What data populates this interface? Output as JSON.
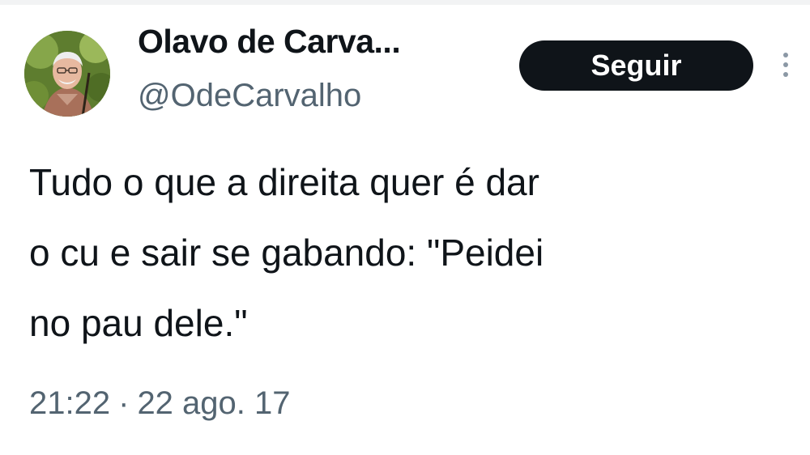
{
  "author": {
    "display_name": "Olavo de Carva...",
    "handle": "@OdeCarvalho"
  },
  "actions": {
    "follow_label": "Seguir",
    "more_icon": "more-vertical-icon"
  },
  "tweet": {
    "text": "Tudo o que a direita quer é dar\no cu e sair se gabando: \"Peidei\nno pau dele.\"",
    "time": "21:22",
    "separator": "·",
    "date": "22 ago. 17"
  },
  "colors": {
    "text_primary": "#0f1419",
    "text_secondary": "#536471",
    "button_bg": "#0f1419",
    "button_text": "#ffffff"
  }
}
